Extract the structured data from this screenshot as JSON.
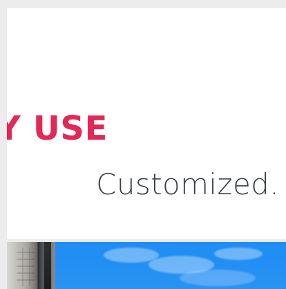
{
  "hero": {
    "headline": "AY USE",
    "subline": "Customized."
  },
  "image_strip": {
    "scene_icon": "building-sky-photo"
  },
  "colors": {
    "page_background": "#ececec",
    "card_background": "#ffffff",
    "headline": "#e32856",
    "subline": "#3a4147",
    "sky": "#238ff4"
  }
}
